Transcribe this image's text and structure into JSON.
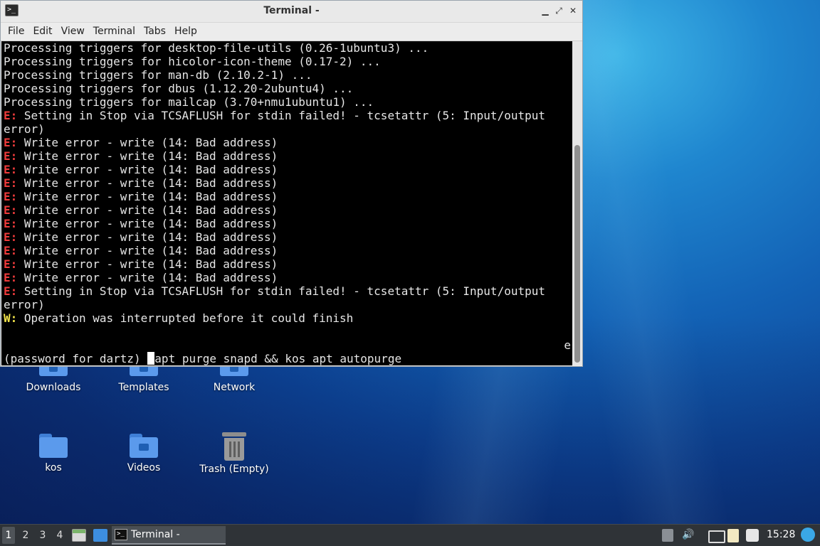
{
  "window": {
    "title": "Terminal -",
    "menu": [
      "File",
      "Edit",
      "View",
      "Terminal",
      "Tabs",
      "Help"
    ]
  },
  "terminal": {
    "lines": [
      {
        "prefix": "",
        "text": "Processing triggers for desktop-file-utils (0.26-1ubuntu3) ..."
      },
      {
        "prefix": "",
        "text": "Processing triggers for hicolor-icon-theme (0.17-2) ..."
      },
      {
        "prefix": "",
        "text": "Processing triggers for man-db (2.10.2-1) ..."
      },
      {
        "prefix": "",
        "text": "Processing triggers for dbus (1.12.20-2ubuntu4) ..."
      },
      {
        "prefix": "",
        "text": "Processing triggers for mailcap (3.70+nmu1ubuntu1) ..."
      },
      {
        "prefix": "E:",
        "text": " Setting in Stop via TCSAFLUSH for stdin failed! - tcsetattr (5: Input/output"
      },
      {
        "prefix": "",
        "text": "error)"
      },
      {
        "prefix": "E:",
        "text": " Write error - write (14: Bad address)"
      },
      {
        "prefix": "E:",
        "text": " Write error - write (14: Bad address)"
      },
      {
        "prefix": "E:",
        "text": " Write error - write (14: Bad address)"
      },
      {
        "prefix": "E:",
        "text": " Write error - write (14: Bad address)"
      },
      {
        "prefix": "E:",
        "text": " Write error - write (14: Bad address)"
      },
      {
        "prefix": "E:",
        "text": " Write error - write (14: Bad address)"
      },
      {
        "prefix": "E:",
        "text": " Write error - write (14: Bad address)"
      },
      {
        "prefix": "E:",
        "text": " Write error - write (14: Bad address)"
      },
      {
        "prefix": "E:",
        "text": " Write error - write (14: Bad address)"
      },
      {
        "prefix": "E:",
        "text": " Write error - write (14: Bad address)"
      },
      {
        "prefix": "E:",
        "text": " Write error - write (14: Bad address)"
      },
      {
        "prefix": "E:",
        "text": " Setting in Stop via TCSAFLUSH for stdin failed! - tcsetattr (5: Input/output"
      },
      {
        "prefix": "",
        "text": "error)"
      },
      {
        "prefix": "W:",
        "text": " Operation was interrupted before it could finish"
      }
    ],
    "edge_char": "e",
    "prompt": "(password for dartz) ",
    "command_after_cursor": "apt purge snapd && kos apt autopurge"
  },
  "desktop": {
    "icons": [
      {
        "label": "Downloads"
      },
      {
        "label": "Templates"
      },
      {
        "label": "Network"
      },
      {
        "label": "kos"
      },
      {
        "label": "Videos"
      },
      {
        "label": "Trash (Empty)"
      }
    ]
  },
  "taskbar": {
    "workspaces": [
      "1",
      "2",
      "3",
      "4"
    ],
    "active_workspace": "1",
    "task_label": "Terminal -",
    "clock": "15:28"
  },
  "colors": {
    "error": "#ef3b3b",
    "warning": "#f2e44a",
    "terminal_bg": "#000000",
    "taskbar_bg": "#2f3337"
  }
}
